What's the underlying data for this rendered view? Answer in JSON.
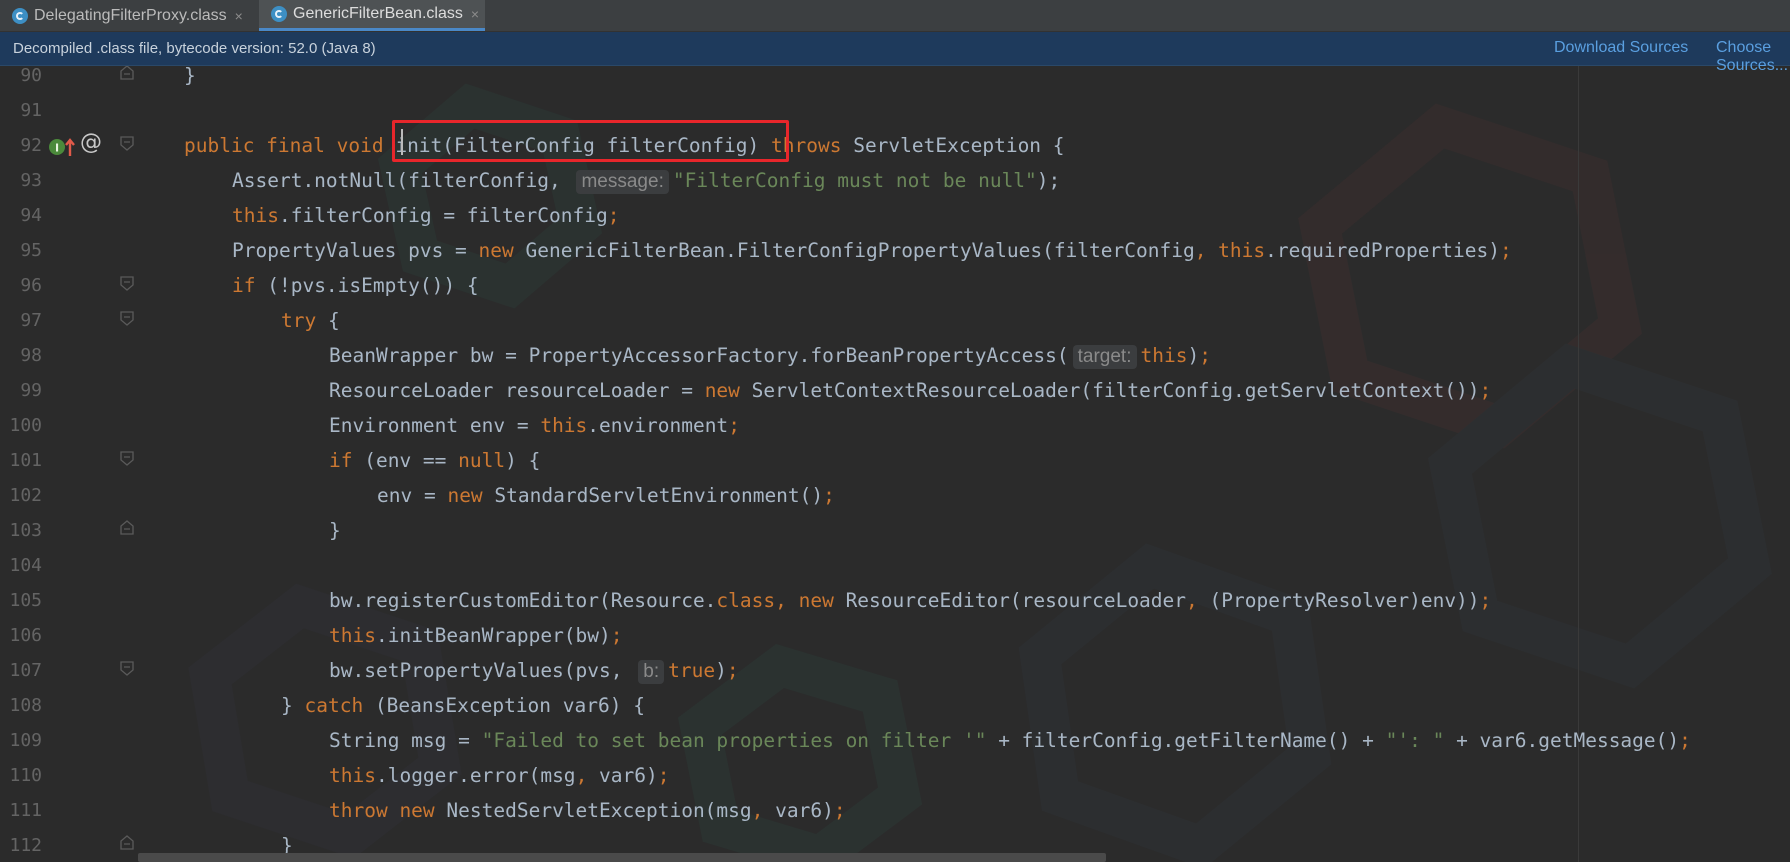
{
  "tabs": [
    {
      "label": "DelegatingFilterProxy.class",
      "close": "×",
      "active": false
    },
    {
      "label": "GenericFilterBean.class",
      "close": "×",
      "active": true
    }
  ],
  "infobar": {
    "message": "Decompiled .class file, bytecode version: 52.0 (Java 8)",
    "download_sources": "Download Sources",
    "choose_sources": "Choose Sources..."
  },
  "gutter": {
    "line_numbers": [
      "90",
      "91",
      "92",
      "93",
      "94",
      "95",
      "96",
      "97",
      "98",
      "99",
      "100",
      "101",
      "102",
      "103",
      "104",
      "105",
      "106",
      "107",
      "108",
      "109",
      "110",
      "111",
      "112"
    ],
    "implements_icon_label": "I",
    "annotation_icon": "@"
  },
  "code": {
    "l90": {
      "t1": "}"
    },
    "l92": {
      "k1": "public final void ",
      "t1": "init(FilterConfig filterConfig) ",
      "k2": "throws ",
      "t2": "ServletException {"
    },
    "l93": {
      "t1": "Assert.notNull(filterConfig, ",
      "hint": "message:",
      "s1": "\"FilterConfig must not be null\"",
      "t2": ");"
    },
    "l94": {
      "k1": "this",
      "t1": ".filterConfig = filterConfig",
      "k2": ";"
    },
    "l95": {
      "t1": "PropertyValues pvs = ",
      "k1": "new ",
      "t2": "GenericFilterBean.FilterConfigPropertyValues(filterConfig",
      "k2": ", this",
      "t3": ".requiredProperties)",
      "k3": ";"
    },
    "l96": {
      "k1": "if ",
      "t1": "(!pvs.isEmpty()) {"
    },
    "l97": {
      "k1": "try ",
      "t1": "{"
    },
    "l98": {
      "t1": "BeanWrapper bw = PropertyAccessorFactory.forBeanPropertyAccess(",
      "hint": "target:",
      "k1": "this",
      "t2": ")",
      "k2": ";"
    },
    "l99": {
      "t1": "ResourceLoader resourceLoader = ",
      "k1": "new ",
      "t2": "ServletContextResourceLoader(filterConfig.getServletContext())",
      "k2": ";"
    },
    "l100": {
      "t1": "Environment env = ",
      "k1": "this",
      "t2": ".environment",
      "k2": ";"
    },
    "l101": {
      "k1": "if ",
      "t1": "(env == ",
      "k2": "null",
      "t2": ") {"
    },
    "l102": {
      "t1": "env = ",
      "k1": "new ",
      "t2": "StandardServletEnvironment()",
      "k2": ";"
    },
    "l103": {
      "t1": "}"
    },
    "l105": {
      "t1": "bw.registerCustomEditor(Resource.",
      "k1": "class, new ",
      "t2": "ResourceEditor(resourceLoader",
      "k2": ", ",
      "t3": "(PropertyResolver)env))",
      "k3": ";"
    },
    "l106": {
      "k1": "this",
      "t1": ".initBeanWrapper(bw)",
      "k2": ";"
    },
    "l107": {
      "t1": "bw.setPropertyValues(pvs, ",
      "hint": "b:",
      "k1": "true",
      "t2": ")",
      "k2": ";"
    },
    "l108": {
      "t1": "} ",
      "k1": "catch ",
      "t2": "(BeansException var6) {"
    },
    "l109": {
      "t1": "String msg = ",
      "s1": "\"Failed to set bean properties on filter '\"",
      "t2": " + filterConfig.getFilterName() + ",
      "s2": "\"': \"",
      "t3": " + var6.getMessage()",
      "k1": ";"
    },
    "l110": {
      "k1": "this",
      "t1": ".logger.error(msg",
      "k2": ", ",
      "t2": "var6)",
      "k3": ";"
    },
    "l111": {
      "k1": "throw new ",
      "t1": "NestedServletException(msg",
      "k2": ", ",
      "t2": "var6)",
      "k3": ";"
    },
    "l112": {
      "t1": "}"
    }
  },
  "colors": {
    "background": "#2b2b2b",
    "keyword": "#cc7832",
    "string": "#6a8759",
    "identifier": "#a9b7c6",
    "highlight_box": "#e8262b",
    "infobar": "#1e3a5c",
    "link": "#5a9fe0"
  }
}
